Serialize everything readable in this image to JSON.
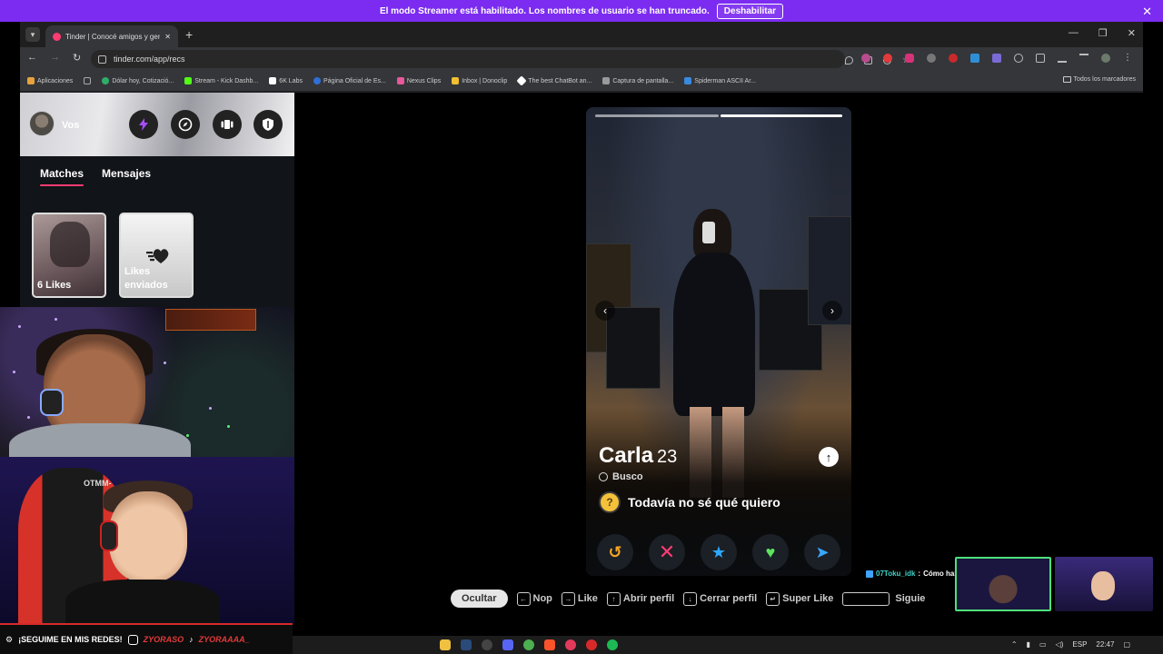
{
  "banner": {
    "message": "El modo Streamer está habilitado. Los nombres de usuario se han truncado.",
    "button_label": "Deshabilitar",
    "close_glyph": "✕",
    "color": "#7b2cf0"
  },
  "browser": {
    "tab_title": "Tinder | Conocé amigos y gente",
    "tab_close": "✕",
    "new_tab": "+",
    "window_controls": [
      "—",
      "❐",
      "✕"
    ],
    "nav_buttons": [
      "←",
      "→",
      "↻"
    ],
    "url": "tinder.com/app/recs",
    "bookmarks": [
      {
        "label": "Aplicaciones",
        "color": "#e8a33c"
      },
      {
        "label": "",
        "color": "#888888"
      },
      {
        "label": "Dólar hoy, Cotizació...",
        "color": "#2fae6b"
      },
      {
        "label": "Stream - Kick Dashb...",
        "color": "#53fc18"
      },
      {
        "label": "6K Labs",
        "color": "#ffffff"
      },
      {
        "label": "Página Oficial de Es...",
        "color": "#2f6fd6"
      },
      {
        "label": "Nexus Clips",
        "color": "#e8589a"
      },
      {
        "label": "Inbox | Donoclip",
        "color": "#f0c030"
      },
      {
        "label": "The best ChatBot an...",
        "color": "#ffffff"
      },
      {
        "label": "Captura de pantalla...",
        "color": "#9a9a9a"
      },
      {
        "label": "Spiderman ASCII Ar...",
        "color": "#3a8ae0"
      }
    ],
    "all_bookmarks": "Todos los marcadores"
  },
  "sidebar": {
    "user_label": "Vos",
    "tabs": {
      "matches": "Matches",
      "messages": "Mensajes"
    },
    "likes_card": "6 Likes",
    "sent_card_line1": "Likes",
    "sent_card_line2": "enviados",
    "accent": "#fe3c72"
  },
  "profile": {
    "name": "Carla",
    "age": "23",
    "looking_for_label": "Busco",
    "goal": "Todavía no sé qué quiero",
    "prev_glyph": "‹",
    "next_glyph": "›",
    "info_glyph": "↑",
    "actions": {
      "rewind": "↺",
      "nope": "✕",
      "super_like": "★",
      "like": "♥",
      "boost": "➤"
    }
  },
  "hints": {
    "hide": "Ocultar",
    "nope": "Nop",
    "like": "Like",
    "open_profile": "Abrir perfil",
    "close_profile": "Cerrar perfil",
    "super_like": "Super Like",
    "next": "Siguie",
    "key_left": "←",
    "key_right": "→",
    "key_up": "↑",
    "key_down": "↓",
    "key_enter": "↵"
  },
  "chat": {
    "user": "07Toku_idk",
    "separator": ":",
    "message": "Cómo habla isa"
  },
  "cams": {
    "chair_brand": "OTMM-"
  },
  "social": {
    "follow_text": "¡SEGUIME EN MIS REDES!",
    "instagram_handle": "ZYORASO",
    "tiktok_handle": "ZYORAAAA_"
  },
  "taskbar": {
    "language": "ESP",
    "time": "22:47"
  }
}
